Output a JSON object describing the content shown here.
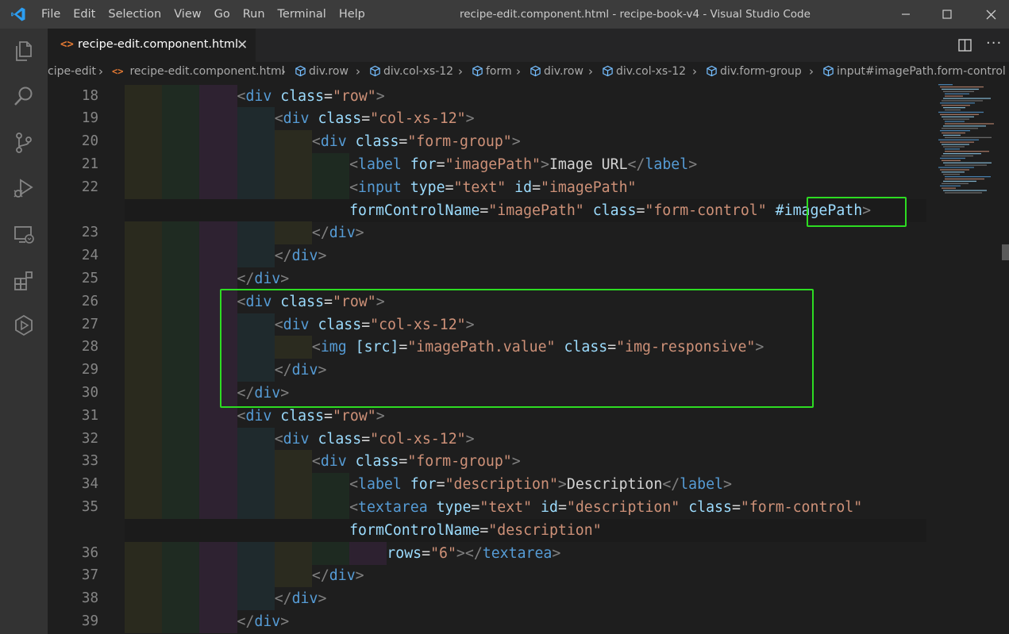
{
  "app": {
    "window_title": "recipe-edit.component.html - recipe-book-v4 - Visual Studio Code",
    "menu": [
      "File",
      "Edit",
      "Selection",
      "View",
      "Go",
      "Run",
      "Terminal",
      "Help"
    ]
  },
  "tab": {
    "label": "recipe-edit.component.html",
    "icon": "html-brackets-icon"
  },
  "breadcrumb": [
    {
      "label": "cipe-edit",
      "icon": ""
    },
    {
      "label": "recipe-edit.component.html",
      "icon": "html-brackets-icon"
    },
    {
      "label": "div.row",
      "icon": "cube-icon"
    },
    {
      "label": "div.col-xs-12",
      "icon": "cube-icon"
    },
    {
      "label": "form",
      "icon": "cube-icon"
    },
    {
      "label": "div.row",
      "icon": "cube-icon"
    },
    {
      "label": "div.col-xs-12",
      "icon": "cube-icon"
    },
    {
      "label": "div.form-group",
      "icon": "cube-icon"
    },
    {
      "label": "input#imagePath.form-control",
      "icon": "cube-icon"
    }
  ],
  "line_numbers": [
    "18",
    "19",
    "20",
    "21",
    "22",
    "23",
    "24",
    "25",
    "26",
    "27",
    "28",
    "29",
    "30",
    "31",
    "32",
    "33",
    "34",
    "35",
    "36",
    "37",
    "38",
    "39"
  ],
  "code_lines": [
    {
      "indent": 3,
      "tokens": [
        [
          "p",
          "<"
        ],
        [
          "t",
          "div"
        ],
        [
          "x",
          " "
        ],
        [
          "a",
          "class"
        ],
        [
          "x",
          "="
        ],
        [
          "s",
          "\"row\""
        ],
        [
          "p",
          ">"
        ]
      ]
    },
    {
      "indent": 4,
      "tokens": [
        [
          "p",
          "<"
        ],
        [
          "t",
          "div"
        ],
        [
          "x",
          " "
        ],
        [
          "a",
          "class"
        ],
        [
          "x",
          "="
        ],
        [
          "s",
          "\"col-xs-12\""
        ],
        [
          "p",
          ">"
        ]
      ]
    },
    {
      "indent": 5,
      "tokens": [
        [
          "p",
          "<"
        ],
        [
          "t",
          "div"
        ],
        [
          "x",
          " "
        ],
        [
          "a",
          "class"
        ],
        [
          "x",
          "="
        ],
        [
          "s",
          "\"form-group\""
        ],
        [
          "p",
          ">"
        ]
      ]
    },
    {
      "indent": 6,
      "tokens": [
        [
          "p",
          "<"
        ],
        [
          "t",
          "label"
        ],
        [
          "x",
          " "
        ],
        [
          "a",
          "for"
        ],
        [
          "x",
          "="
        ],
        [
          "s",
          "\"imagePath\""
        ],
        [
          "p",
          ">"
        ],
        [
          "x",
          "Image URL"
        ],
        [
          "p",
          "</"
        ],
        [
          "t",
          "label"
        ],
        [
          "p",
          ">"
        ]
      ]
    },
    {
      "indent": 6,
      "tokens": [
        [
          "p",
          "<"
        ],
        [
          "t",
          "input"
        ],
        [
          "x",
          " "
        ],
        [
          "a",
          "type"
        ],
        [
          "x",
          "="
        ],
        [
          "s",
          "\"text\""
        ],
        [
          "x",
          " "
        ],
        [
          "a",
          "id"
        ],
        [
          "x",
          "="
        ],
        [
          "s",
          "\"imagePath\""
        ]
      ]
    },
    {
      "indent": 6,
      "wrap": true,
      "tokens": [
        [
          "a",
          "formControlName"
        ],
        [
          "x",
          "="
        ],
        [
          "s",
          "\"imagePath\""
        ],
        [
          "x",
          " "
        ],
        [
          "a",
          "class"
        ],
        [
          "x",
          "="
        ],
        [
          "s",
          "\"form-control\""
        ],
        [
          "x",
          " "
        ],
        [
          "a",
          "#imagePath"
        ],
        [
          "p",
          ">"
        ]
      ]
    },
    {
      "indent": 5,
      "tokens": [
        [
          "p",
          "</"
        ],
        [
          "t",
          "div"
        ],
        [
          "p",
          ">"
        ]
      ]
    },
    {
      "indent": 4,
      "tokens": [
        [
          "p",
          "</"
        ],
        [
          "t",
          "div"
        ],
        [
          "p",
          ">"
        ]
      ]
    },
    {
      "indent": 3,
      "tokens": [
        [
          "p",
          "</"
        ],
        [
          "t",
          "div"
        ],
        [
          "p",
          ">"
        ]
      ]
    },
    {
      "indent": 3,
      "tokens": [
        [
          "p",
          "<"
        ],
        [
          "t",
          "div"
        ],
        [
          "x",
          " "
        ],
        [
          "a",
          "class"
        ],
        [
          "x",
          "="
        ],
        [
          "s",
          "\"row\""
        ],
        [
          "p",
          ">"
        ]
      ]
    },
    {
      "indent": 4,
      "tokens": [
        [
          "p",
          "<"
        ],
        [
          "t",
          "div"
        ],
        [
          "x",
          " "
        ],
        [
          "a",
          "class"
        ],
        [
          "x",
          "="
        ],
        [
          "s",
          "\"col-xs-12\""
        ],
        [
          "p",
          ">"
        ]
      ]
    },
    {
      "indent": 5,
      "tokens": [
        [
          "p",
          "<"
        ],
        [
          "t",
          "img"
        ],
        [
          "x",
          " "
        ],
        [
          "a",
          "[src]"
        ],
        [
          "x",
          "="
        ],
        [
          "s",
          "\"imagePath.value\""
        ],
        [
          "x",
          " "
        ],
        [
          "a",
          "class"
        ],
        [
          "x",
          "="
        ],
        [
          "s",
          "\"img-responsive\""
        ],
        [
          "p",
          ">"
        ]
      ]
    },
    {
      "indent": 4,
      "tokens": [
        [
          "p",
          "</"
        ],
        [
          "t",
          "div"
        ],
        [
          "p",
          ">"
        ]
      ]
    },
    {
      "indent": 3,
      "tokens": [
        [
          "p",
          "</"
        ],
        [
          "t",
          "div"
        ],
        [
          "p",
          ">"
        ]
      ]
    },
    {
      "indent": 3,
      "tokens": [
        [
          "p",
          "<"
        ],
        [
          "t",
          "div"
        ],
        [
          "x",
          " "
        ],
        [
          "a",
          "class"
        ],
        [
          "x",
          "="
        ],
        [
          "s",
          "\"row\""
        ],
        [
          "p",
          ">"
        ]
      ]
    },
    {
      "indent": 4,
      "tokens": [
        [
          "p",
          "<"
        ],
        [
          "t",
          "div"
        ],
        [
          "x",
          " "
        ],
        [
          "a",
          "class"
        ],
        [
          "x",
          "="
        ],
        [
          "s",
          "\"col-xs-12\""
        ],
        [
          "p",
          ">"
        ]
      ]
    },
    {
      "indent": 5,
      "tokens": [
        [
          "p",
          "<"
        ],
        [
          "t",
          "div"
        ],
        [
          "x",
          " "
        ],
        [
          "a",
          "class"
        ],
        [
          "x",
          "="
        ],
        [
          "s",
          "\"form-group\""
        ],
        [
          "p",
          ">"
        ]
      ]
    },
    {
      "indent": 6,
      "tokens": [
        [
          "p",
          "<"
        ],
        [
          "t",
          "label"
        ],
        [
          "x",
          " "
        ],
        [
          "a",
          "for"
        ],
        [
          "x",
          "="
        ],
        [
          "s",
          "\"description\""
        ],
        [
          "p",
          ">"
        ],
        [
          "x",
          "Description"
        ],
        [
          "p",
          "</"
        ],
        [
          "t",
          "label"
        ],
        [
          "p",
          ">"
        ]
      ]
    },
    {
      "indent": 6,
      "tokens": [
        [
          "p",
          "<"
        ],
        [
          "t",
          "textarea"
        ],
        [
          "x",
          " "
        ],
        [
          "a",
          "type"
        ],
        [
          "x",
          "="
        ],
        [
          "s",
          "\"text\""
        ],
        [
          "x",
          " "
        ],
        [
          "a",
          "id"
        ],
        [
          "x",
          "="
        ],
        [
          "s",
          "\"description\""
        ],
        [
          "x",
          " "
        ],
        [
          "a",
          "class"
        ],
        [
          "x",
          "="
        ],
        [
          "s",
          "\"form-control\""
        ]
      ]
    },
    {
      "indent": 6,
      "wrap": true,
      "tokens": [
        [
          "a",
          "formControlName"
        ],
        [
          "x",
          "="
        ],
        [
          "s",
          "\"description\""
        ]
      ]
    },
    {
      "indent": 7,
      "tokens": [
        [
          "a",
          "rows"
        ],
        [
          "x",
          "="
        ],
        [
          "s",
          "\"6\""
        ],
        [
          "p",
          "></"
        ],
        [
          "t",
          "textarea"
        ],
        [
          "p",
          ">"
        ]
      ]
    },
    {
      "indent": 5,
      "tokens": [
        [
          "p",
          "</"
        ],
        [
          "t",
          "div"
        ],
        [
          "p",
          ">"
        ]
      ]
    },
    {
      "indent": 4,
      "tokens": [
        [
          "p",
          "</"
        ],
        [
          "t",
          "div"
        ],
        [
          "p",
          ">"
        ]
      ]
    },
    {
      "indent": 3,
      "tokens": [
        [
          "p",
          "</"
        ],
        [
          "t",
          "div"
        ],
        [
          "p",
          ">"
        ]
      ]
    }
  ],
  "colors": {
    "tag": "#569cd6",
    "punct": "#808080",
    "attr": "#9cdcfe",
    "string": "#ce9178",
    "text": "#d4d4d4",
    "highlight": "#2ddc22",
    "indent_bands": [
      "#2a2a1e",
      "#1f2b22",
      "#2e2231",
      "#1f2a2d",
      "#2b2b1f",
      "#1e2a21",
      "#2d2130"
    ]
  }
}
